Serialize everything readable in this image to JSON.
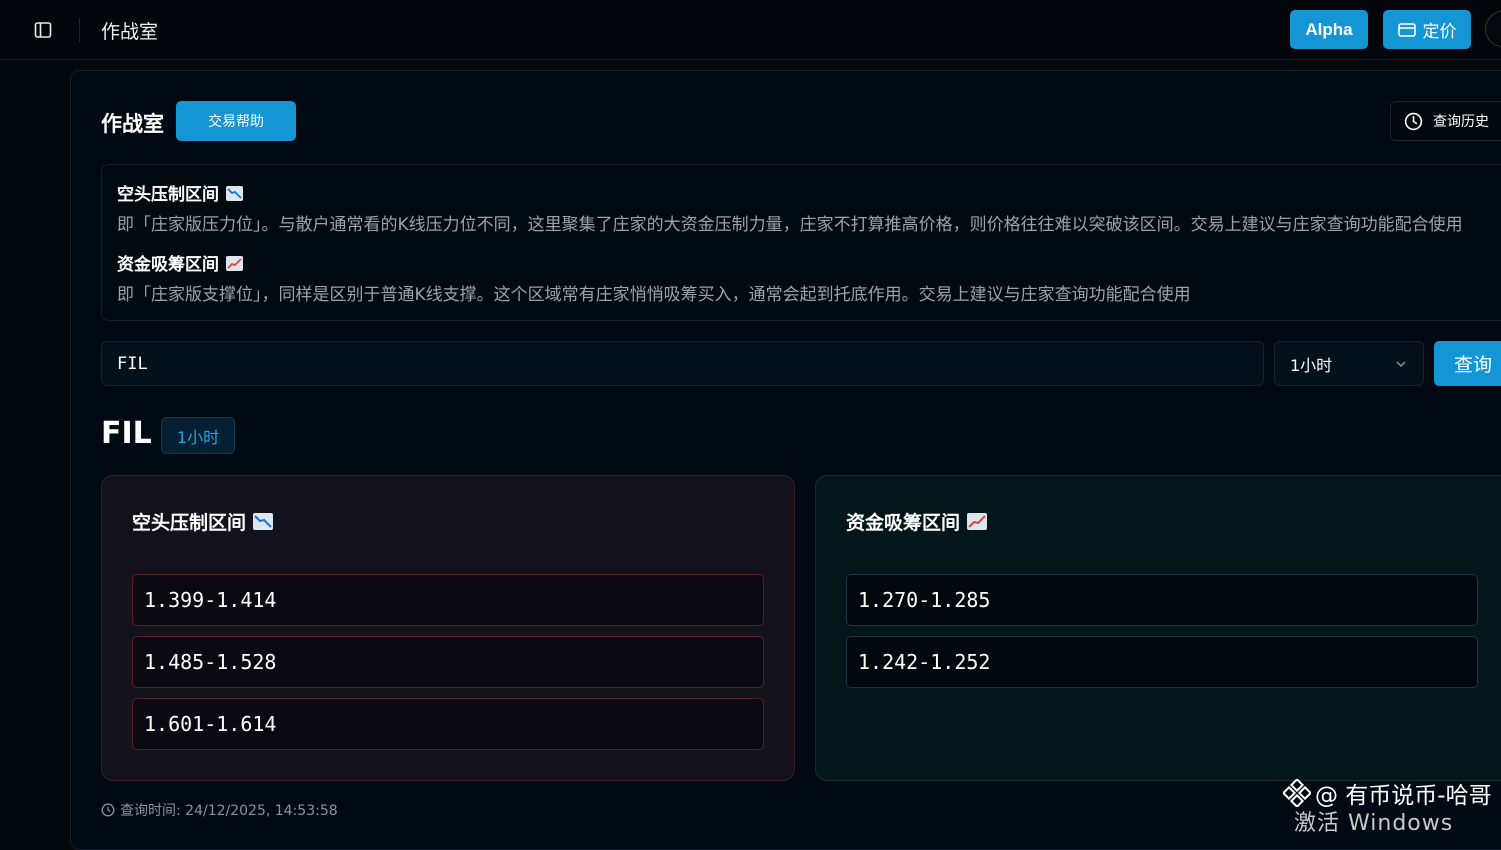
{
  "topbar": {
    "title": "作战室",
    "alpha_label": "Alpha",
    "pricing_label": "定价"
  },
  "page": {
    "title": "作战室",
    "help_label": "交易帮助",
    "history_label": "查询历史"
  },
  "info": {
    "short_title": "空头压制区间",
    "short_desc": "即「庄家版压力位」。与散户通常看的K线压力位不同，这里聚集了庄家的大资金压制力量，庄家不打算推高价格，则价格往往难以突破该区间。交易上建议与庄家查询功能配合使用",
    "long_title": "资金吸筹区间",
    "long_desc": "即「庄家版支撑位」，同样是区别于普通K线支撑。这个区域常有庄家悄悄吸筹买入，通常会起到托底作用。交易上建议与庄家查询功能配合使用"
  },
  "search": {
    "symbol_value": "FIL",
    "interval_value": "1小时",
    "query_label": "查询"
  },
  "result": {
    "symbol": "FIL",
    "interval": "1小时",
    "short_title": "空头压制区间",
    "short_ranges": [
      "1.399-1.414",
      "1.485-1.528",
      "1.601-1.614"
    ],
    "long_title": "资金吸筹区间",
    "long_ranges": [
      "1.270-1.285",
      "1.242-1.252"
    ],
    "query_time": "查询时间: 24/12/2025, 14:53:58"
  },
  "watermark": {
    "line1": "@ 有币说币-哈哥",
    "line2": "激活 Windows"
  },
  "colors": {
    "accent": "#1496d4",
    "short_border": "#5a1f25",
    "long_card_bg": "#04161a"
  }
}
